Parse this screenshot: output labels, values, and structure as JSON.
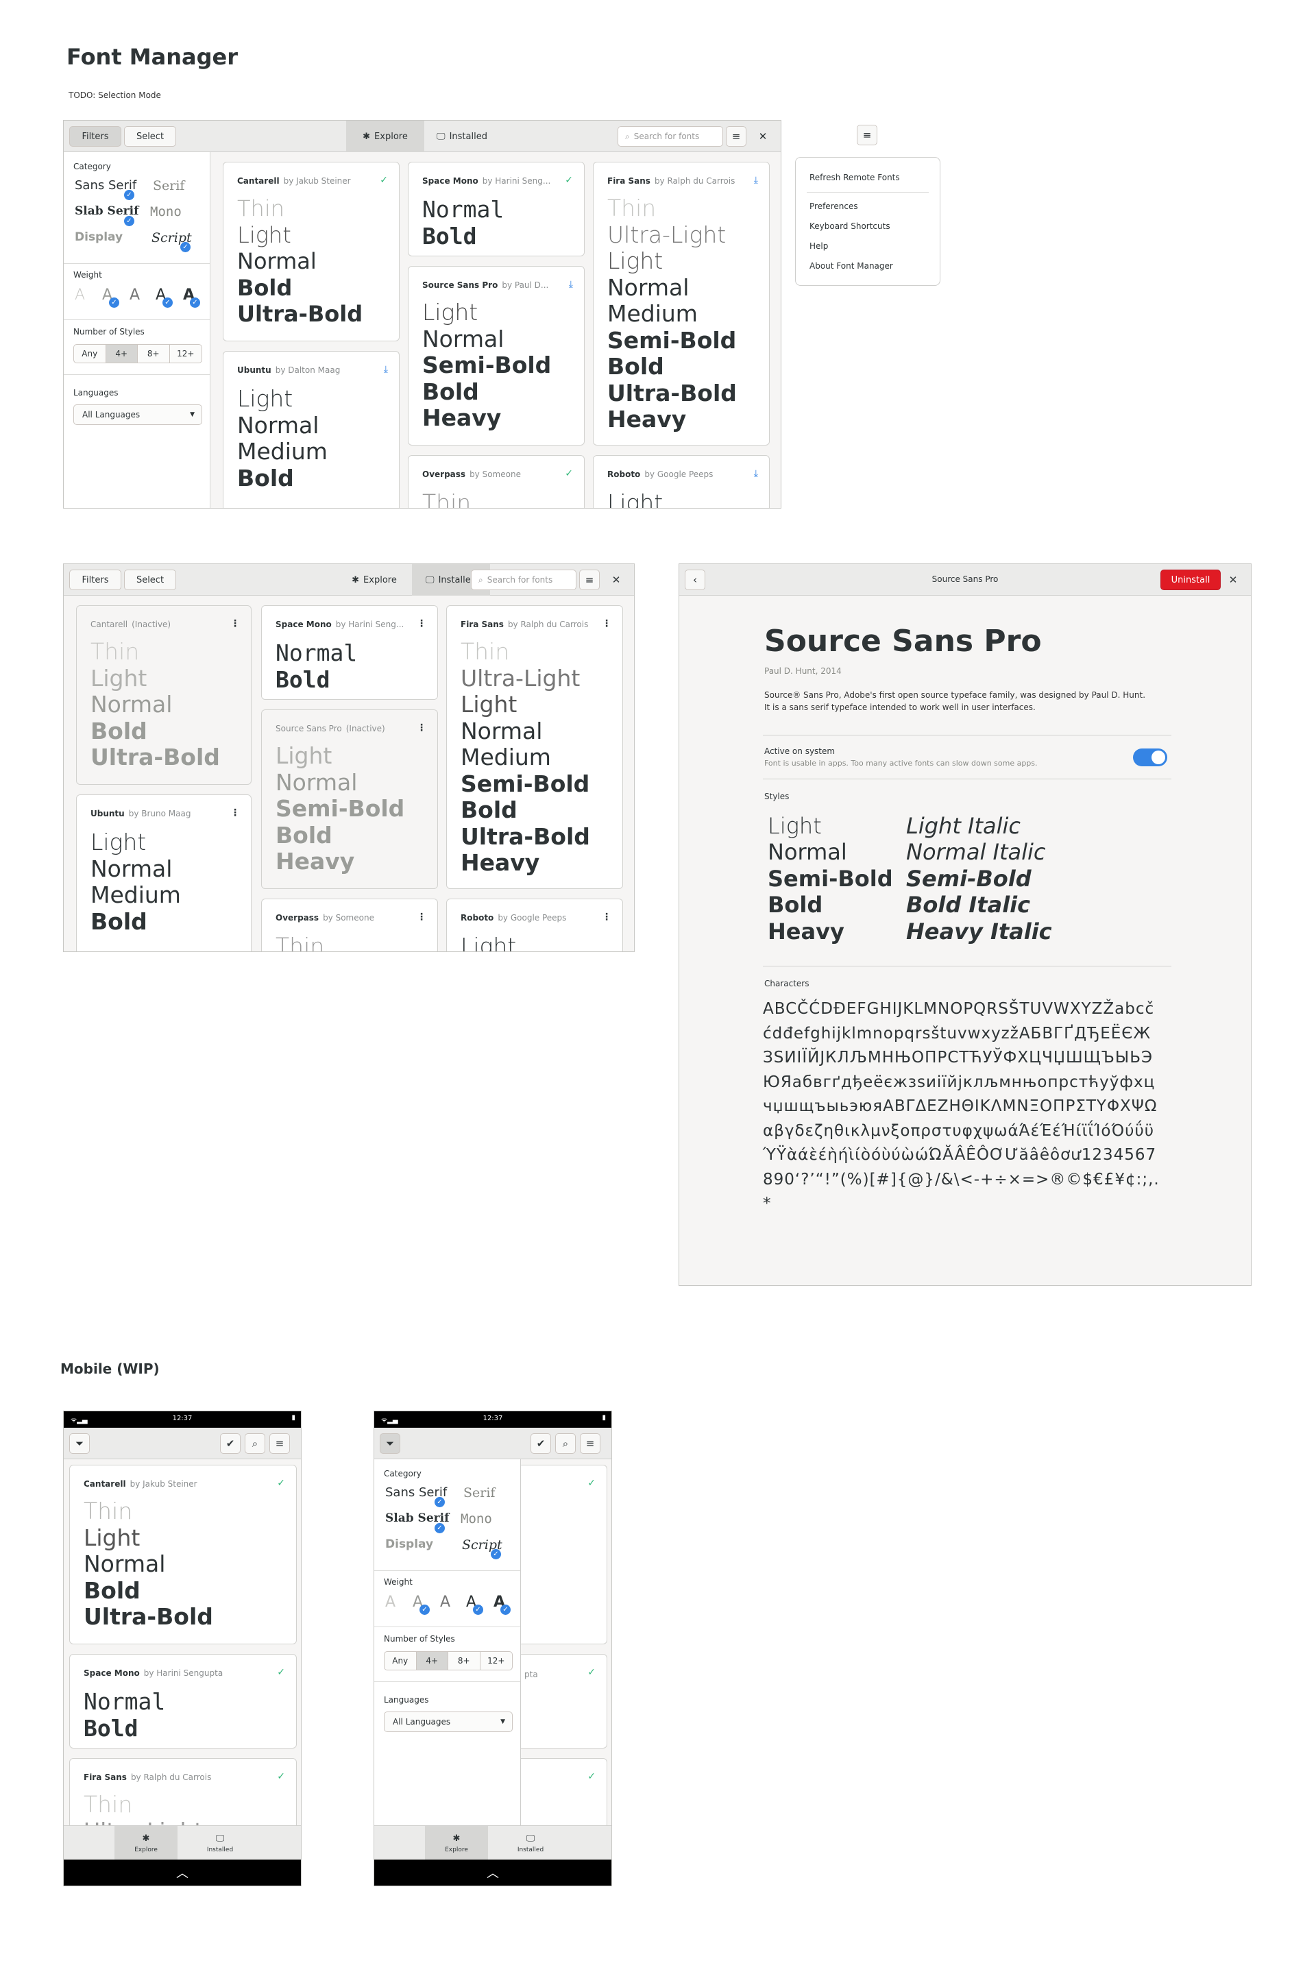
{
  "page": {
    "title": "Font Manager",
    "todo": "TODO: Selection Mode",
    "mobile_heading": "Mobile (WIP)"
  },
  "header": {
    "filters": "Filters",
    "select": "Select",
    "explore": "Explore",
    "installed": "Installed",
    "search_placeholder": "Search for fonts"
  },
  "filters": {
    "category_label": "Category",
    "categories": [
      "Sans Serif",
      "Serif",
      "Slab Serif",
      "Mono",
      "Display",
      "Script"
    ],
    "weight_label": "Weight",
    "weight_glyph": "A",
    "styles_label": "Number of Styles",
    "styles_options": [
      "Any",
      "4+",
      "8+",
      "12+"
    ],
    "languages_label": "Languages",
    "languages_value": "All Languages"
  },
  "explore_cards": [
    {
      "name": "Cantarell",
      "author": "by Jakub Steiner",
      "styles": [
        "Thin",
        "Light",
        "Normal",
        "Bold",
        "Ultra-Bold"
      ]
    },
    {
      "name": "Ubuntu",
      "author": "by Dalton Maag",
      "styles": [
        "Light",
        "Normal",
        "Medium",
        "Bold"
      ]
    },
    {
      "name": "Space Mono",
      "author": "by Harini Seng...",
      "styles": [
        "Normal",
        "Bold"
      ]
    },
    {
      "name": "Source Sans Pro",
      "author": "by Paul D...",
      "styles": [
        "Light",
        "Normal",
        "Semi-Bold",
        "Bold",
        "Heavy"
      ]
    },
    {
      "name": "Overpass",
      "author": "by Someone",
      "styles": [
        "Thin"
      ]
    },
    {
      "name": "Fira Sans",
      "author": "by Ralph du Carrois",
      "styles": [
        "Thin",
        "Ultra-Light",
        "Light",
        "Normal",
        "Medium",
        "Semi-Bold",
        "Bold",
        "Ultra-Bold",
        "Heavy"
      ]
    },
    {
      "name": "Roboto",
      "author": "by Google Peeps",
      "styles": [
        "Light"
      ]
    }
  ],
  "installed_cards": [
    {
      "name": "Cantarell",
      "author": "(Inactive)"
    },
    {
      "name": "Ubuntu",
      "author": "by Bruno Maag"
    },
    {
      "name": "Space Mono",
      "author": "by Harini Seng..."
    },
    {
      "name": "Source Sans Pro",
      "author": "(Inactive)"
    },
    {
      "name": "Overpass",
      "author": "by Someone"
    },
    {
      "name": "Fira Sans",
      "author": "by Ralph du Carrois"
    },
    {
      "name": "Roboto",
      "author": "by Google Peeps"
    }
  ],
  "popover": {
    "refresh": "Refresh Remote Fonts",
    "preferences": "Preferences",
    "shortcuts": "Keyboard Shortcuts",
    "help": "Help",
    "about": "About Font Manager"
  },
  "details": {
    "header_title": "Source Sans Pro",
    "uninstall": "Uninstall",
    "title": "Source Sans Pro",
    "subtitle": "Paul D. Hunt, 2014",
    "desc1": "Source® Sans Pro, Adobe's first open source typeface family, was designed by Paul D. Hunt.",
    "desc2": "It is a sans serif typeface intended to work well in user interfaces.",
    "active_title": "Active on system",
    "active_sub": "Font is usable in apps. Too many active fonts can slow down some apps.",
    "styles_label": "Styles",
    "styles_upright": [
      "Light",
      "Normal",
      "Semi-Bold",
      "Bold",
      "Heavy"
    ],
    "styles_italic": [
      "Light Italic",
      "Normal Italic",
      "Semi-Bold",
      "Bold Italic",
      "Heavy Italic"
    ],
    "characters_label": "Characters",
    "characters": "ABCČĆDĐEFGHIJKLMNOPQRSŠTUVWXYZŽabcčćdđefghijklmnopqrsštuvwxyzžАБВГҐДЂЕЁЄЖЗЅИІЇЙЈКЛЉМНЊОПРСТЋУЎФХЦЧЏШЩЪЫЬЭЮЯабвгґдђеёєжзѕиіїйјклљмнњопрстћуўфхцчџшщъыьэюяΑΒΓΔΕΖΗΘΙΚΛΜΝΞΟΠΡΣΤΥΦΧΨΩαβγδεζηθικλμνξοπρστυφχψωάΆέΈέΉίϊΐΊόΌύΰϋΎΫὰάὲέὴήὶίὸόὺύὼώΏĂÂÊÔƠƯăâêôơư1234567890‘?’“!”(%)[#]{@}/&\\<-+÷×=>®©$€£¥¢:;,.*"
  },
  "mobile": {
    "time": "12:37",
    "cards": [
      {
        "name": "Cantarell",
        "author": "by Jakub Steiner",
        "styles": [
          "Thin",
          "Light",
          "Normal",
          "Bold",
          "Ultra-Bold"
        ]
      },
      {
        "name": "Space Mono",
        "author": "by Harini Sengupta",
        "styles": [
          "Normal",
          "Bold"
        ]
      },
      {
        "name": "Fira Sans",
        "author": "by Ralph du Carrois",
        "styles": [
          "Thin",
          "Ultra-Light"
        ]
      }
    ],
    "explore": "Explore",
    "installed": "Installed",
    "peek": "pta"
  }
}
